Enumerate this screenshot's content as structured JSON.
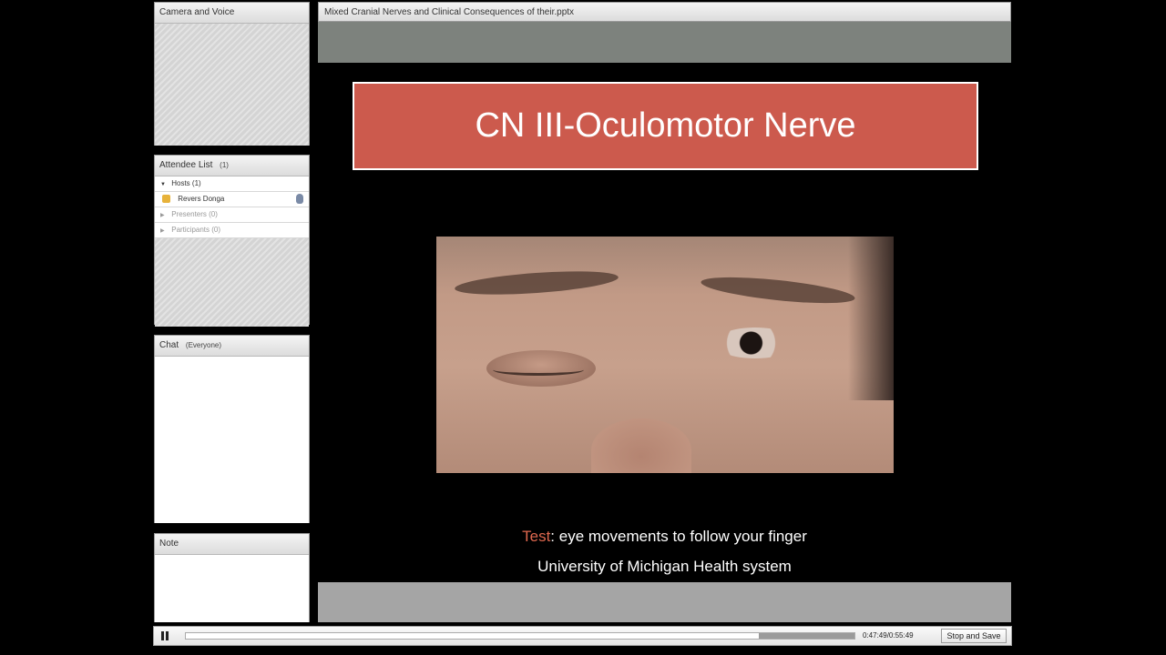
{
  "camera_pod": {
    "title": "Camera and Voice"
  },
  "attendee_pod": {
    "title": "Attendee List",
    "count": "(1)",
    "groups": [
      {
        "label": "Hosts (1)",
        "expanded": true
      },
      {
        "label": "Presenters (0)",
        "expanded": false
      },
      {
        "label": "Participants (0)",
        "expanded": false
      }
    ],
    "host_user": "Revers Donga"
  },
  "chat_pod": {
    "title": "Chat",
    "scope": "(Everyone)"
  },
  "note_pod": {
    "title": "Note"
  },
  "share_pod": {
    "title": "Mixed Cranial Nerves and Clinical Consequences of their.pptx"
  },
  "slide": {
    "title": "CN III-Oculomotor Nerve",
    "test_keyword": "Test",
    "test_text": ": eye movements to follow your finger",
    "credit": "University of Michigan Health system",
    "title_color": "#cc5a4d",
    "keyword_color": "#e0684f"
  },
  "playback": {
    "time": "0:47:49/0:55:49",
    "progress": 0.857,
    "stop_label": "Stop and Save"
  }
}
